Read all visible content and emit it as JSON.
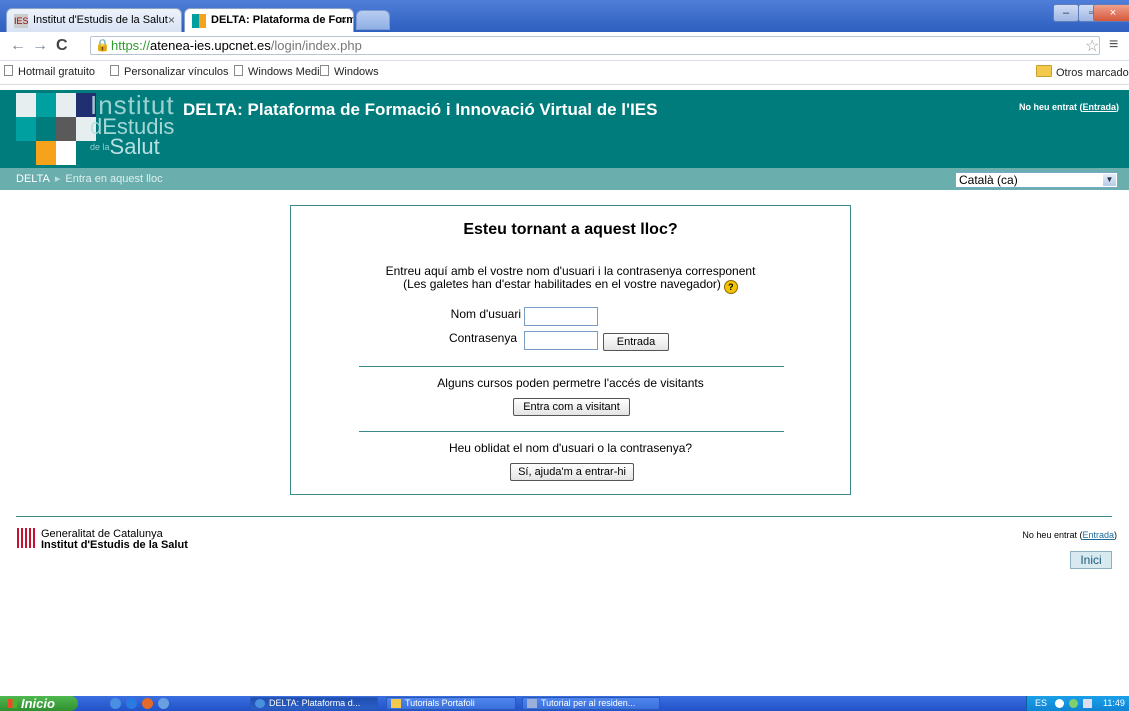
{
  "browser": {
    "tabs": [
      {
        "label": "Institut d'Estudis de la Salut",
        "active": false
      },
      {
        "label": "DELTA: Plataforma de Forma",
        "active": true
      }
    ],
    "url_scheme": "https://",
    "url_host": "atenea-ies.upcnet.es",
    "url_path": "/login/index.php",
    "bookmarks": [
      "Hotmail gratuito",
      "Personalizar vínculos",
      "Windows Media",
      "Windows"
    ],
    "other_bookmarks": "Otros marcadores"
  },
  "header": {
    "logo_line1": "Institut",
    "logo_line2_prefix": "d",
    "logo_line2": "Estudis",
    "logo_line3_prefix": "de la",
    "logo_line3": "Salut",
    "title": "DELTA: Plataforma de Formació i Innovació Virtual de l'IES",
    "login_text": "No heu entrat (",
    "login_link": "Entrada",
    "login_close": ")",
    "logo_colors": [
      "#e6eef0",
      "#1f2f6f",
      "#00a0a0",
      "#5a5a5a",
      "#ffffff",
      "#f7a21b"
    ]
  },
  "breadcrumb": {
    "home": "DELTA",
    "current": "Entra en aquest lloc",
    "separator": "▸"
  },
  "language": {
    "selected": "Català (ca)"
  },
  "login": {
    "heading": "Esteu tornant a aquest lloc?",
    "desc_line1": "Entreu aquí amb el vostre nom d'usuari i la contrasenya corresponent",
    "desc_line2": "(Les galetes han d'estar habilitades en el vostre navegador)",
    "username_label": "Nom d'usuari",
    "password_label": "Contrasenya",
    "submit_label": "Entrada",
    "guest_text": "Alguns cursos poden permetre l'accés de visitants",
    "guest_button": "Entra com a visitant",
    "forgot_text": "Heu oblidat el nom d'usuari o la contrasenya?",
    "forgot_button": "Sí, ajuda'm a entrar-hi"
  },
  "footer": {
    "gencat_line1": "Generalitat de Catalunya",
    "gencat_line2": "Institut d'Estudis de la Salut",
    "login_text": "No heu entrat (",
    "login_link": "Entrada",
    "login_close": ")",
    "home_button": "Inici"
  },
  "taskbar": {
    "start": "Inicio",
    "items": [
      "DELTA: Plataforma d...",
      "Tutorials Portafoli",
      "Tutorial per al residen..."
    ],
    "tray_lang": "ES",
    "clock": "11:49"
  }
}
